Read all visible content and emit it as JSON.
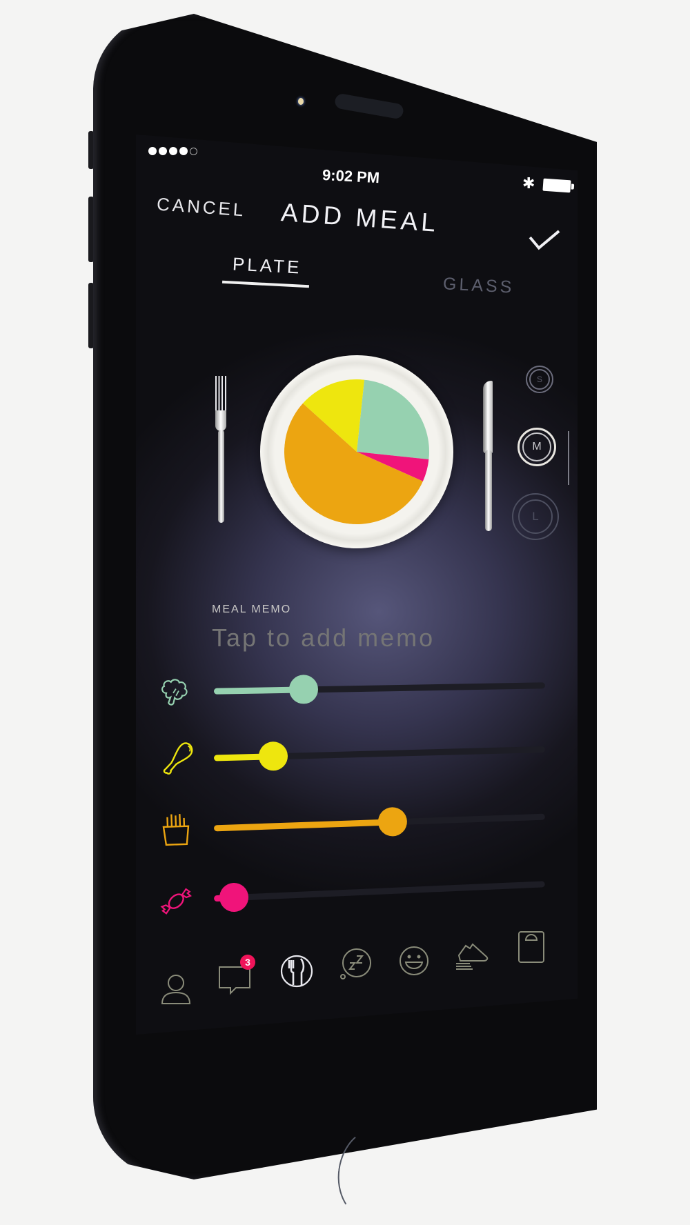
{
  "status_bar": {
    "signal_bars_filled": 4,
    "signal_bars_total": 5,
    "time": "9:02 PM",
    "bluetooth_icon": "bluetooth-icon",
    "battery_icon": "battery-full-icon"
  },
  "header": {
    "cancel_label": "CANCEL",
    "title": "ADD MEAL",
    "confirm_icon": "checkmark-icon"
  },
  "tabs": [
    {
      "label": "PLATE",
      "active": true
    },
    {
      "label": "GLASS",
      "active": false
    }
  ],
  "plate": {
    "fork_icon": "fork-icon",
    "knife_icon": "knife-icon",
    "portions": [
      {
        "name": "vegetables",
        "value": 25,
        "color": "#96d1b0"
      },
      {
        "name": "sweets",
        "value": 5,
        "color": "#f0147a"
      },
      {
        "name": "carbs",
        "value": 55,
        "color": "#eca511"
      },
      {
        "name": "protein",
        "value": 15,
        "color": "#eee60e"
      }
    ]
  },
  "size_selector": {
    "options": [
      {
        "label": "S",
        "selected": false
      },
      {
        "label": "M",
        "selected": true
      },
      {
        "label": "L",
        "selected": false
      }
    ]
  },
  "memo": {
    "label": "MEAL MEMO",
    "placeholder": "Tap to add memo"
  },
  "sliders": [
    {
      "name": "vegetables",
      "icon": "broccoli-icon",
      "value": 0.27,
      "color": "#96d1b0"
    },
    {
      "name": "protein",
      "icon": "chicken-leg-icon",
      "value": 0.18,
      "color": "#eee60e"
    },
    {
      "name": "carbs",
      "icon": "fries-icon",
      "value": 0.54,
      "color": "#eca511"
    },
    {
      "name": "sweets",
      "icon": "candy-icon",
      "value": 0.06,
      "color": "#f0147a"
    }
  ],
  "bottom_nav": {
    "items": [
      {
        "name": "profile",
        "icon": "person-icon"
      },
      {
        "name": "messages",
        "icon": "chat-bubble-icon",
        "badge": "3"
      },
      {
        "name": "meals",
        "icon": "plate-cutlery-icon",
        "active": true
      },
      {
        "name": "sleep",
        "icon": "sleep-zz-icon"
      },
      {
        "name": "mood",
        "icon": "smiley-icon"
      },
      {
        "name": "activity",
        "icon": "sneaker-icon"
      },
      {
        "name": "weight",
        "icon": "scale-icon"
      }
    ]
  }
}
